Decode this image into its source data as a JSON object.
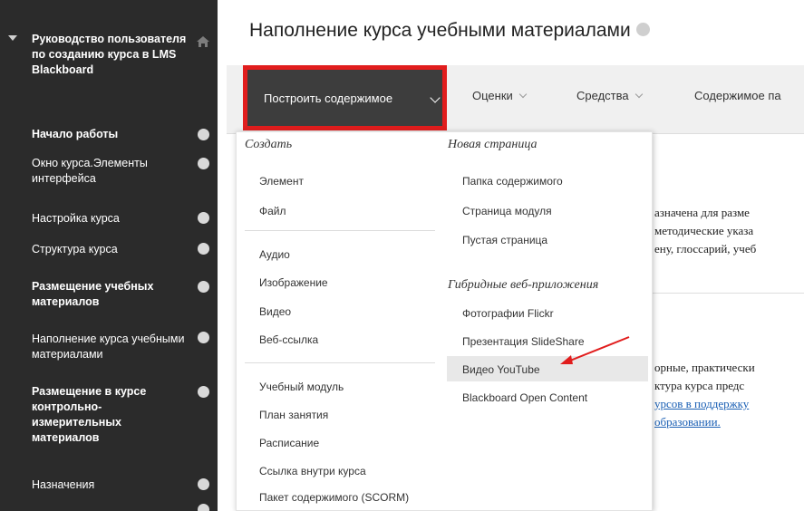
{
  "sidebar": {
    "items": [
      {
        "label": "Руководство пользователя по созданию курса в LMS Blackboard",
        "icon": "home-icon"
      },
      {
        "label": "Начало работы",
        "icon": "circle-icon"
      },
      {
        "label": "Окно курса.Элементы интерфейса",
        "icon": "circle-icon"
      },
      {
        "label": "Настройка курса",
        "icon": "circle-icon"
      },
      {
        "label": "Структура курса",
        "icon": "circle-icon"
      },
      {
        "label": "Размещение учебных материалов",
        "icon": "circle-icon"
      },
      {
        "label": "Наполнение курса учебными материалами",
        "icon": "circle-icon"
      },
      {
        "label": "Размещение в курсе контрольно-измерительных материалов",
        "icon": "circle-icon"
      },
      {
        "label": "Назначения",
        "icon": "circle-icon"
      }
    ]
  },
  "header": {
    "title": "Наполнение курса учебными материалами"
  },
  "toolbar": {
    "build": "Построить содержимое",
    "grades": "Оценки",
    "tools": "Средства",
    "content": "Содержимое па"
  },
  "dropdown": {
    "create_heading": "Создать",
    "create_group1": [
      "Элемент",
      "Файл"
    ],
    "create_group2": [
      "Аудио",
      "Изображение",
      "Видео",
      "Веб-ссылка"
    ],
    "create_group3": [
      "Учебный модуль",
      "План занятия",
      "Расписание",
      "Ссылка внутри курса",
      "Пакет содержимого (SCORM)"
    ],
    "newpage_heading": "Новая страница",
    "newpage_items": [
      "Папка содержимого",
      "Страница модуля",
      "Пустая страница"
    ],
    "hybrid_heading": "Гибридные веб-приложения",
    "hybrid_items": [
      "Фотографии Flickr",
      "Презентация SlideShare",
      "Видео YouTube",
      "Blackboard Open Content"
    ]
  },
  "background_text": {
    "line1": "азначена для разме",
    "line2": "методические указа",
    "line3": "ену, глоссарий, учеб",
    "line4": "орные, практически",
    "line5": "ктура курса предс",
    "line6": "урсов в поддержку",
    "line7": "образовании."
  },
  "colors": {
    "sidebar_bg": "#2b2b2b",
    "highlight_border": "#e11d1d",
    "build_button_bg": "#3d3d3d",
    "link": "#1a5fb4"
  }
}
